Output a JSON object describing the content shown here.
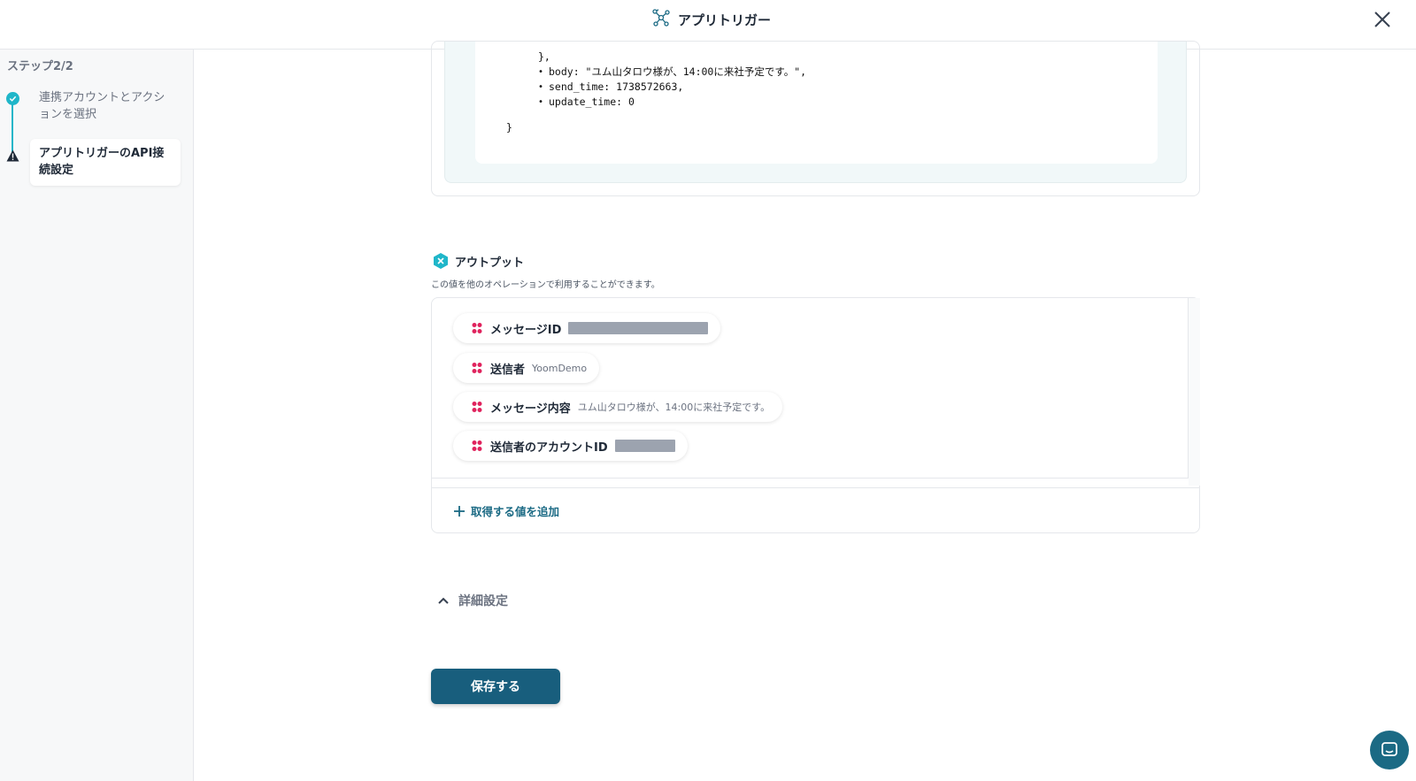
{
  "header": {
    "title": "アプリトリガー",
    "logo_icon": "network-logo-icon",
    "close_icon": "close-icon"
  },
  "sidebar": {
    "step_header": "ステップ2/2",
    "steps": [
      {
        "label": "連携アカウントとアクションを選択",
        "status": "completed",
        "icon": "check-circle-icon"
      },
      {
        "label": "アプリトリガーのAPI接続設定",
        "status": "warning",
        "icon": "warning-triangle-icon"
      }
    ]
  },
  "code_preview": {
    "closing_brace_inner": "},",
    "items": [
      "body: \"ユム山タロウ様が、14:00に来社予定です。\",",
      "send_time: 1738572663,",
      "update_time: 0"
    ],
    "closing_brace_outer": "}"
  },
  "output": {
    "title": "アウトプット",
    "description": "この値を他のオペレーションで利用することができます。",
    "fields": [
      {
        "name": "メッセージID",
        "value": "",
        "redacted": true
      },
      {
        "name": "送信者",
        "value": "YoomDemo",
        "redacted": false
      },
      {
        "name": "メッセージ内容",
        "value": "ユム山タロウ様が、14:00に来社予定です。",
        "redacted": false
      },
      {
        "name": "送信者のアカウントID",
        "value": "",
        "redacted": true
      }
    ],
    "add_label": "取得する値を追加"
  },
  "advanced": {
    "label": "詳細設定"
  },
  "save_button": {
    "label": "保存する"
  },
  "colors": {
    "accent": "#1fb6c9",
    "primary": "#185e7d",
    "link": "#1b6a84",
    "chip_icon": "#e0245e"
  }
}
